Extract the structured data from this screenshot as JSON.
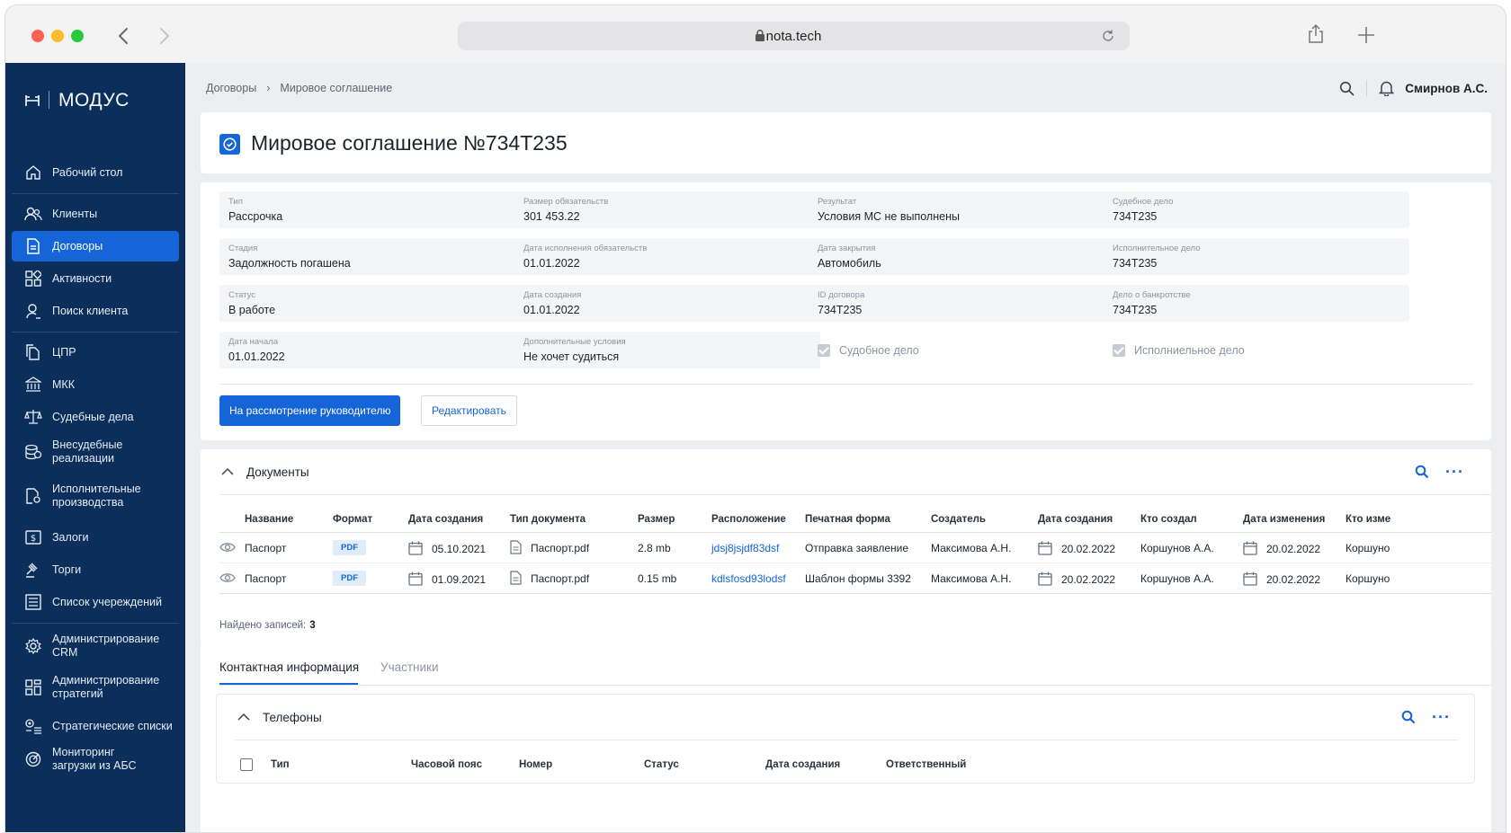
{
  "browser": {
    "url": "nota.tech"
  },
  "sidebar": {
    "logo": "МОДУС",
    "items": [
      {
        "label": "Рабочий стол",
        "icon": "home-icon"
      },
      {
        "label": "Клиенты",
        "icon": "users-icon"
      },
      {
        "label": "Договоры",
        "icon": "document-icon",
        "active": true
      },
      {
        "label": "Активности",
        "icon": "grid-icon"
      },
      {
        "label": "Поиск клиента",
        "icon": "user-search-icon"
      },
      {
        "label": "ЦПР",
        "icon": "files-icon"
      },
      {
        "label": "МКК",
        "icon": "bank-icon"
      },
      {
        "label": "Судебные дела",
        "icon": "scales-icon"
      },
      {
        "label": "Внесудебные реализации",
        "icon": "coins-icon"
      },
      {
        "label": "Исполнительные производства",
        "icon": "file-stamp-icon"
      },
      {
        "label": "Залоги",
        "icon": "pledge-icon"
      },
      {
        "label": "Торги",
        "icon": "gavel-icon"
      },
      {
        "label": "Список учереждений",
        "icon": "list-icon"
      },
      {
        "label": "Администрирование CRM",
        "icon": "gear-icon"
      },
      {
        "label": "Администрирование стратегий",
        "icon": "strategy-grid-icon"
      },
      {
        "label": "Стратегические списки",
        "icon": "gear-list-icon"
      },
      {
        "label": "Мониторинг загрузки из АБС",
        "icon": "monitor-icon"
      }
    ]
  },
  "header": {
    "breadcrumb": [
      "Договоры",
      "Мировое соглашение"
    ],
    "user": "Смирнов А.С."
  },
  "page": {
    "title": "Мировое соглашение №734Т235"
  },
  "fields": [
    {
      "label": "Тип",
      "value": "Рассрочка"
    },
    {
      "label": "Размер обязательств",
      "value": "301 453.22"
    },
    {
      "label": "Результат",
      "value": "Условия МС не выполнены"
    },
    {
      "label": "Судебное дело",
      "value": "734Т235"
    },
    {
      "label": "Стадия",
      "value": "Задолжность погашена"
    },
    {
      "label": "Дата исполнения обязательств",
      "value": "01.01.2022"
    },
    {
      "label": "Дата закрытия",
      "value": "Автомобиль"
    },
    {
      "label": "Исполнительное дело",
      "value": "734Т235"
    },
    {
      "label": "Статус",
      "value": "В работе"
    },
    {
      "label": "Дата создания",
      "value": "01.01.2022"
    },
    {
      "label": "ID договора",
      "value": "734Т235"
    },
    {
      "label": "Дело о банкротстве",
      "value": "734Т235"
    },
    {
      "label": "Дата начала",
      "value": "01.01.2022"
    },
    {
      "label": "Дополнительные условия",
      "value": "Не хочет судиться"
    }
  ],
  "checkboxes": [
    {
      "label": "Судобное дело",
      "checked": true
    },
    {
      "label": "Исполниельное дело",
      "checked": true
    }
  ],
  "actions": {
    "primary": "На рассмотрение руководителю",
    "edit": "Редактировать"
  },
  "documents": {
    "title": "Документы",
    "columns": [
      "Название",
      "Формат",
      "Дата создания",
      "Тип документа",
      "Размер",
      "Расположение",
      "Печатная форма",
      "Создатель",
      "Дата создания",
      "Кто создал",
      "Дата изменения",
      "Кто изме"
    ],
    "rows": [
      {
        "name": "Паспорт",
        "format": "PDF",
        "created": "05.10.2021",
        "doc_type": "Паспорт.pdf",
        "size": "2.8 mb",
        "location": "jdsj8jsjdf83dsf",
        "print_form": "Отправка заявление",
        "creator": "Максимова А.Н.",
        "created2": "20.02.2022",
        "created_by": "Коршунов А.А.",
        "modified": "20.02.2022",
        "modified_by": "Коршуно"
      },
      {
        "name": "Паспорт",
        "format": "PDF",
        "created": "01.09.2021",
        "doc_type": "Паспорт.pdf",
        "size": "0.15 mb",
        "location": "kdlsfosd93lodsf",
        "print_form": "Шаблон формы 3392",
        "creator": "Максимова А.Н.",
        "created2": "20.02.2022",
        "created_by": "Коршунов А.А.",
        "modified": "20.02.2022",
        "modified_by": "Коршуно"
      }
    ],
    "found_label": "Найдено записей:",
    "found_count": "3"
  },
  "tabs": [
    {
      "label": "Контактная информация",
      "active": true
    },
    {
      "label": "Участники",
      "active": false
    }
  ],
  "phones": {
    "title": "Телефоны",
    "columns": [
      "Тип",
      "Часовой пояс",
      "Номер",
      "Статус",
      "Дата создания",
      "Ответственный"
    ]
  },
  "colors": {
    "sidebar": "#0b2e5a",
    "accent": "#1565d8",
    "background": "#eceef1"
  }
}
